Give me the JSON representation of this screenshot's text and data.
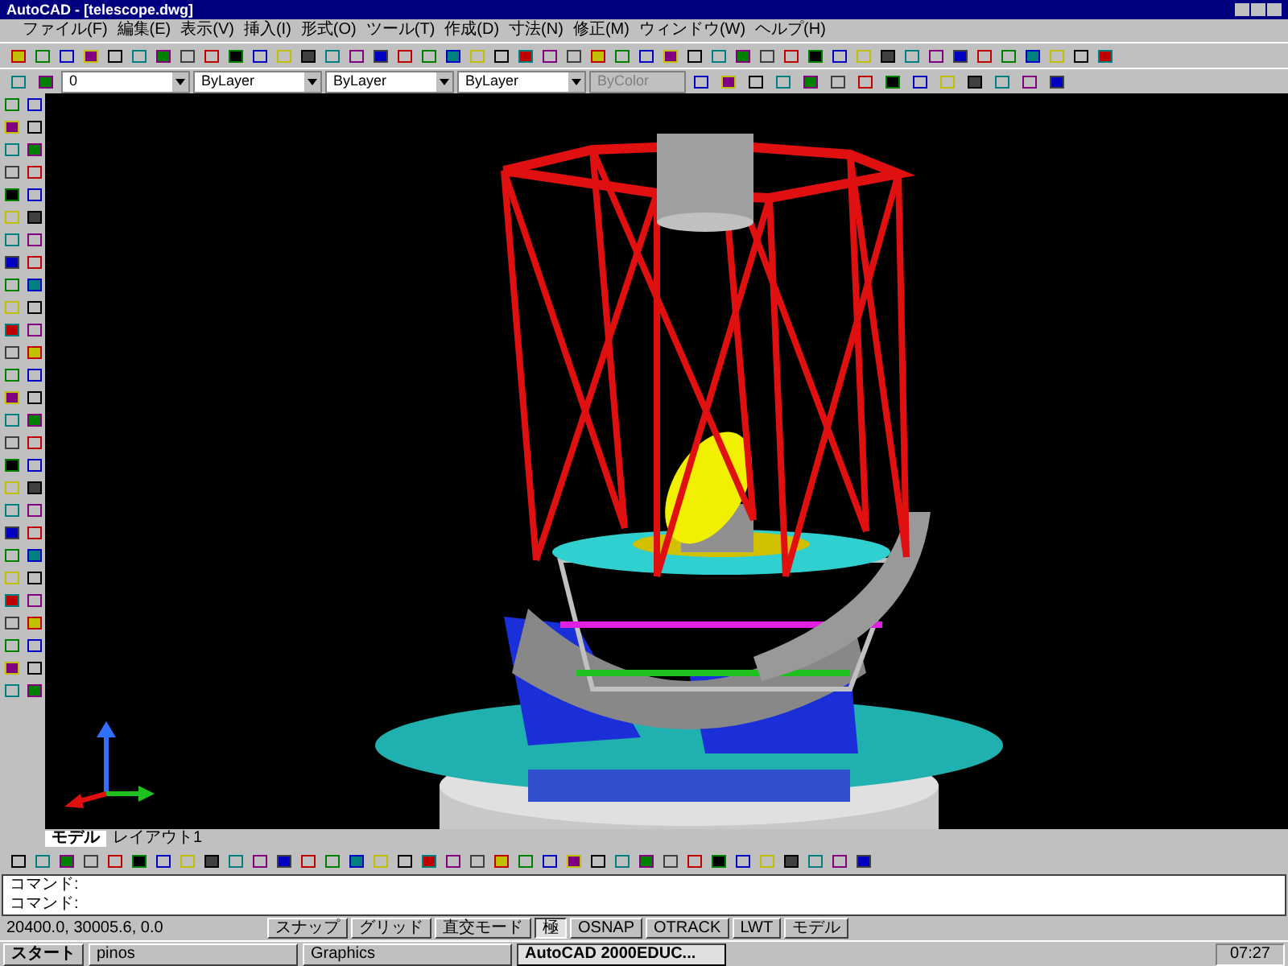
{
  "window": {
    "title": "AutoCAD - [telescope.dwg]"
  },
  "menu": [
    "ファイル(F)",
    "編集(E)",
    "表示(V)",
    "挿入(I)",
    "形式(O)",
    "ツール(T)",
    "作成(D)",
    "寸法(N)",
    "修正(M)",
    "ウィンドウ(W)",
    "ヘルプ(H)"
  ],
  "properties_bar": {
    "layer": "0",
    "color_setting": "ByLayer",
    "linetype": "ByLayer",
    "lineweight": "ByLayer",
    "plotstyle": "ByColor"
  },
  "layout_tabs": [
    {
      "label": "モデル",
      "selected": true
    },
    {
      "label": "レイアウト1",
      "selected": false
    }
  ],
  "command_lines": [
    "コマンド:",
    "コマンド:"
  ],
  "status_bar": {
    "coordinates": "20400.0, 30005.6, 0.0",
    "buttons": [
      {
        "label": "スナップ",
        "on": false
      },
      {
        "label": "グリッド",
        "on": false
      },
      {
        "label": "直交モード",
        "on": false
      },
      {
        "label": "極",
        "on": true
      },
      {
        "label": "OSNAP",
        "on": false
      },
      {
        "label": "OTRACK",
        "on": false
      },
      {
        "label": "LWT",
        "on": false
      },
      {
        "label": "モデル",
        "on": false
      }
    ]
  },
  "taskbar": {
    "start": "スタート",
    "tasks": [
      {
        "label": "pinos",
        "selected": false
      },
      {
        "label": "Graphics",
        "selected": false
      },
      {
        "label": "AutoCAD 2000EDUC...",
        "selected": true
      }
    ],
    "clock": "07:27"
  }
}
